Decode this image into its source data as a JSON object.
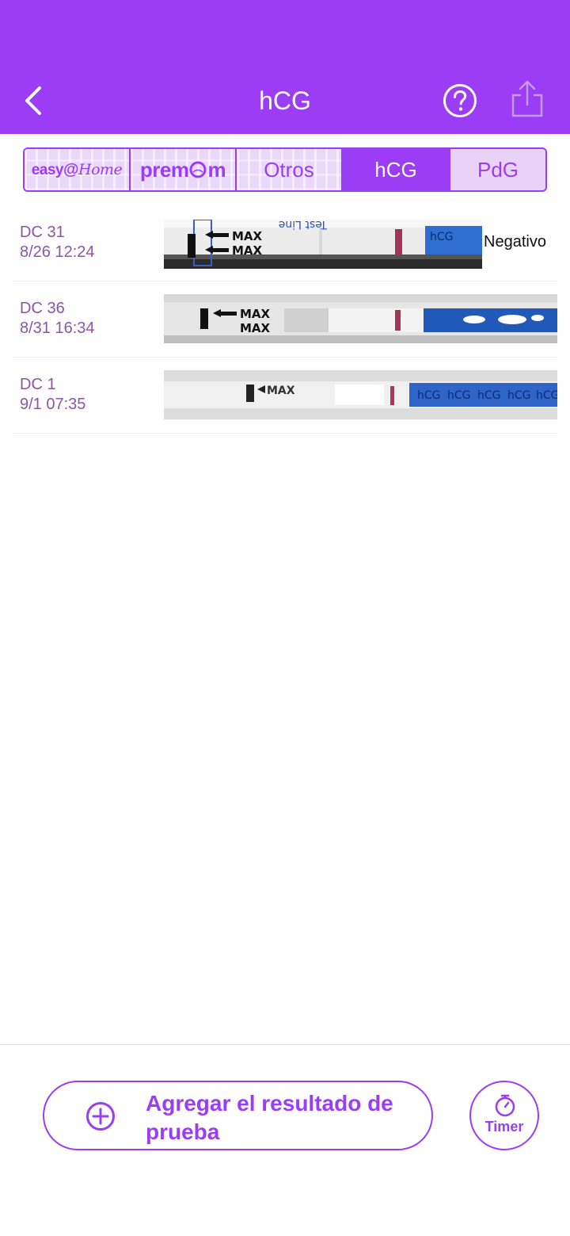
{
  "header": {
    "title": "hCG",
    "back_icon": "chevron-left-icon",
    "help_icon": "question-circle-icon",
    "share_icon": "share-icon",
    "background": "#9b3df5"
  },
  "tabs": [
    {
      "label": "easy@Home",
      "kind": "logo",
      "selected": false
    },
    {
      "label": "premom",
      "kind": "logo",
      "selected": false
    },
    {
      "label": "Otros",
      "kind": "text",
      "selected": false
    },
    {
      "label": "hCG",
      "kind": "text",
      "selected": true
    },
    {
      "label": "PdG",
      "kind": "text",
      "selected": false
    }
  ],
  "tests": [
    {
      "dc": "DC 31",
      "datetime": "8/26 12:24",
      "result": "Negativo"
    },
    {
      "dc": "DC 36",
      "datetime": "8/31 16:34",
      "result": ""
    },
    {
      "dc": "DC 1",
      "datetime": "9/1 07:35",
      "result": ""
    }
  ],
  "strip_text": {
    "max": "MAX",
    "test_line": "Test Line",
    "hcg": "hCG"
  },
  "footer": {
    "add_label": "Agregar el resultado de prueba",
    "add_icon": "plus-circle-icon",
    "timer_label": "Timer",
    "timer_icon": "stopwatch-icon"
  },
  "colors": {
    "accent": "#9b3df5",
    "date_text": "#8d55a8",
    "tab_inactive": "#e8d3f7"
  }
}
